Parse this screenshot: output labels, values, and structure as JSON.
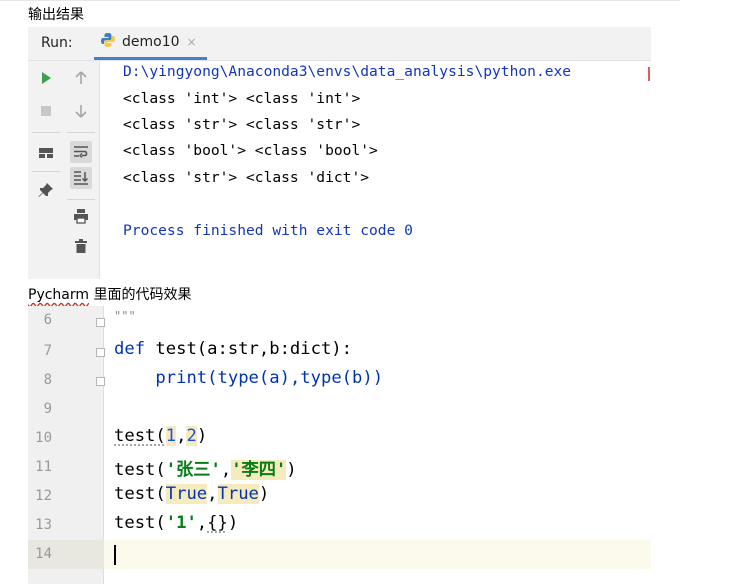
{
  "captions": {
    "output": "输出结果",
    "pycharm_prefix": "Pycharm",
    "pycharm_suffix": " 里面的代码效果"
  },
  "run_panel": {
    "label": "Run:",
    "tab_name": "demo10",
    "tab_close": "×",
    "console_lines": [
      "D:\\yingyong\\Anaconda3\\envs\\data_analysis\\python.exe",
      "<class 'int'> <class 'int'>",
      "<class 'str'> <class 'str'>",
      "<class 'bool'> <class 'bool'>",
      "<class 'str'> <class 'dict'>",
      "",
      "Process finished with exit code 0"
    ]
  },
  "editor": {
    "line_numbers": [
      "6",
      "7",
      "8",
      "9",
      "10",
      "11",
      "12",
      "13",
      "14"
    ],
    "lines": {
      "l6": "\"\"\"",
      "l7_def": "def",
      "l7_rest": " test(a:str,b:dict):",
      "l8_indent": "    ",
      "l8_print": "print",
      "l8_rest": "(type(a),type(b))",
      "l10_fn": "test(",
      "l10_a": "1",
      "l10_comma": ",",
      "l10_b": "2",
      "l10_end": ")",
      "l11_fn": "test(",
      "l11_a": "'张三'",
      "l11_comma": ",",
      "l11_b": "'李四'",
      "l11_end": ")",
      "l12_fn": "test(",
      "l12_a": "True",
      "l12_comma": ",",
      "l12_b": "True",
      "l12_end": ")",
      "l13_fn": "test(",
      "l13_a": "'1'",
      "l13_comma": ",",
      "l13_b": "{}",
      "l13_end": ")"
    }
  },
  "colors": {
    "keyword": "#0033b3",
    "string": "#067d17",
    "number": "#1750eb",
    "highlight": "#f6ebbc",
    "run_green": "#3ea04a"
  },
  "icons": [
    "python-file-icon",
    "run-icon",
    "stop-icon",
    "up-arrow-icon",
    "down-arrow-icon",
    "soft-wrap-icon",
    "scroll-to-end-icon",
    "layout-icon",
    "pin-icon",
    "print-icon",
    "trash-icon"
  ]
}
